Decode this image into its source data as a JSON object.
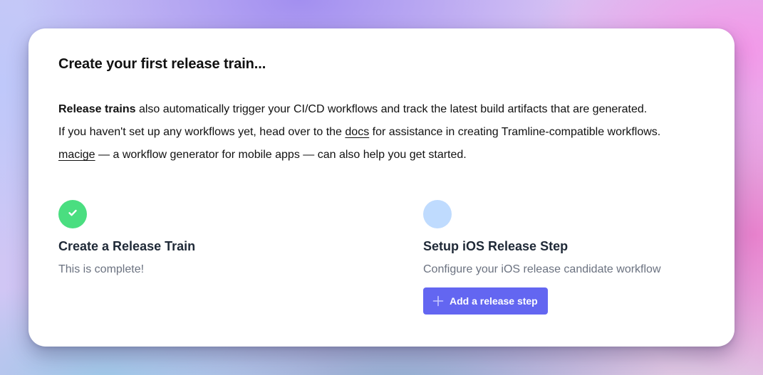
{
  "card": {
    "title": "Create your first release train...",
    "intro": {
      "line1_bold": "Release trains",
      "line1_rest": " also automatically trigger your CI/CD workflows and track the latest build artifacts that are generated.",
      "line2_before": "If you haven't set up any workflows yet, head over to the ",
      "line2_link": "docs",
      "line2_after": " for assistance in creating Tramline-compatible workflows.",
      "line3_link": "macige",
      "line3_rest": " — a workflow generator for mobile apps — can also help you get started."
    }
  },
  "steps": [
    {
      "status": "complete",
      "icon": "check-icon",
      "color": "#4ade80",
      "title": "Create a Release Train",
      "description": "This is complete!"
    },
    {
      "status": "pending",
      "icon": "",
      "color": "#bfdbfe",
      "title": "Setup iOS Release Step",
      "description": "Configure your iOS release candidate workflow",
      "button": {
        "icon": "plus-icon",
        "label": "Add a release step",
        "color": "#6366f1"
      }
    }
  ]
}
